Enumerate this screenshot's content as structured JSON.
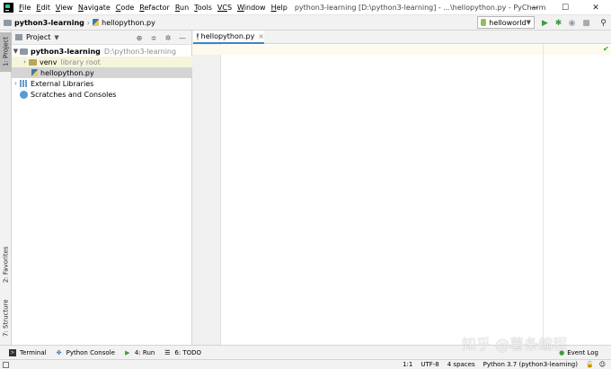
{
  "menu": [
    {
      "key": "F",
      "rest": "ile"
    },
    {
      "key": "E",
      "rest": "dit"
    },
    {
      "key": "V",
      "rest": "iew"
    },
    {
      "key": "N",
      "rest": "avigate"
    },
    {
      "key": "C",
      "rest": "ode"
    },
    {
      "key": "R",
      "rest": "efactor"
    },
    {
      "key": "R",
      "rest": "un"
    },
    {
      "key": "T",
      "rest": "ools"
    },
    {
      "key": "VC",
      "rest": "S"
    },
    {
      "key": "W",
      "rest": "indow"
    },
    {
      "key": "H",
      "rest": "elp"
    }
  ],
  "window_title": "python3-learning [D:\\python3-learning] - ...\\hellopython.py - PyCharm",
  "breadcrumbs": [
    "python3-learning",
    "hellopython.py"
  ],
  "run_config": "helloworld",
  "left_stripe": {
    "project": "1: Project",
    "favorites": "2: Favorites",
    "structure": "7: Structure"
  },
  "project_panel": {
    "title": "Project",
    "tree": {
      "root_name": "python3-learning",
      "root_path": "D:\\python3-learning",
      "venv_name": "venv",
      "venv_note": "library root",
      "file_name": "hellopython.py",
      "external_libraries": "External Libraries",
      "scratches": "Scratches and Consoles"
    }
  },
  "editor": {
    "tab_label": "hellopython.py"
  },
  "bottom_tools": {
    "terminal": "Terminal",
    "python_console": "Python Console",
    "run": "4: Run",
    "todo": "6: TODO",
    "event_log": "Event Log"
  },
  "status": {
    "position": "1:1",
    "encoding": "UTF-8",
    "indent": "4 spaces",
    "interpreter": "Python 3.7 (python3-learning)"
  },
  "watermark": "知乎 @薯条编程",
  "colors": {
    "accent": "#4083c9",
    "run_green": "#3a9c3a",
    "selection": "#d5d5d5"
  }
}
